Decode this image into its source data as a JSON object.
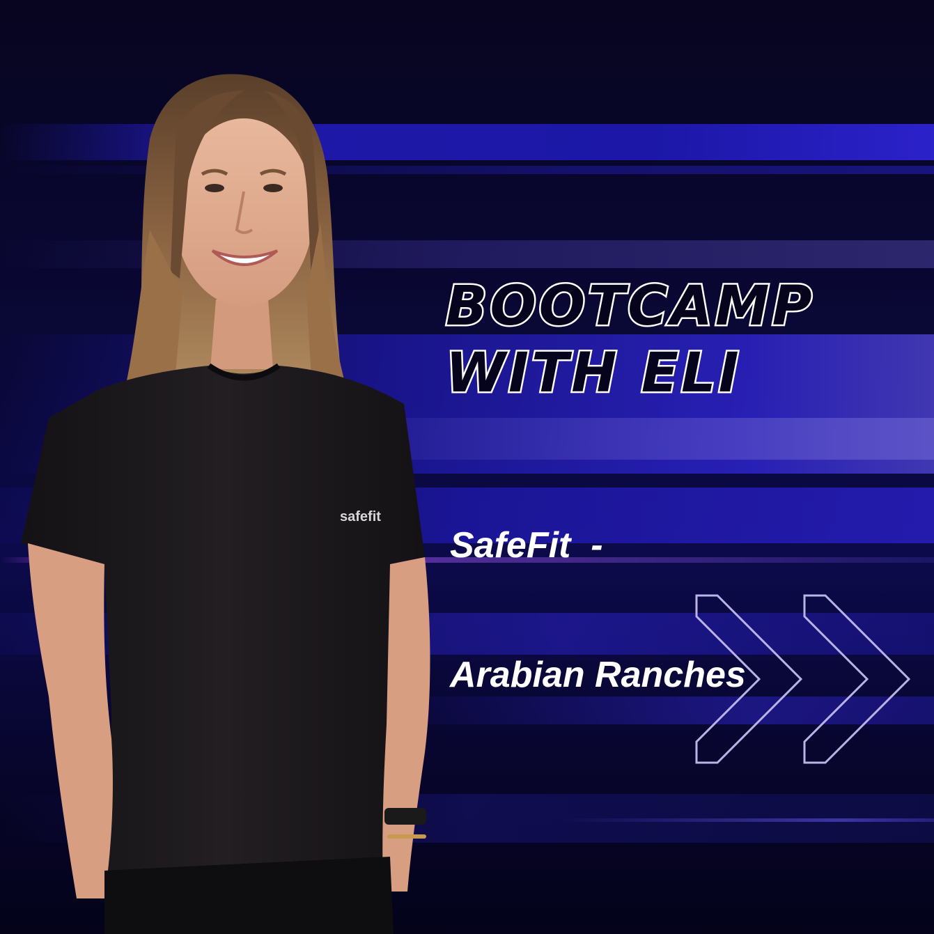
{
  "headline": {
    "line1": "BOOTCAMP",
    "line2": "WITH ELI"
  },
  "subline": {
    "line1": "SafeFit  -",
    "line2": "Arabian Ranches"
  },
  "shirt_logo": "safefit",
  "decoration": {
    "icon": "double-chevron-right-icon"
  },
  "colors": {
    "background": "#0a0838",
    "accent_blue": "#2a22c0",
    "text": "#ffffff",
    "shirt": "#1a1719"
  }
}
